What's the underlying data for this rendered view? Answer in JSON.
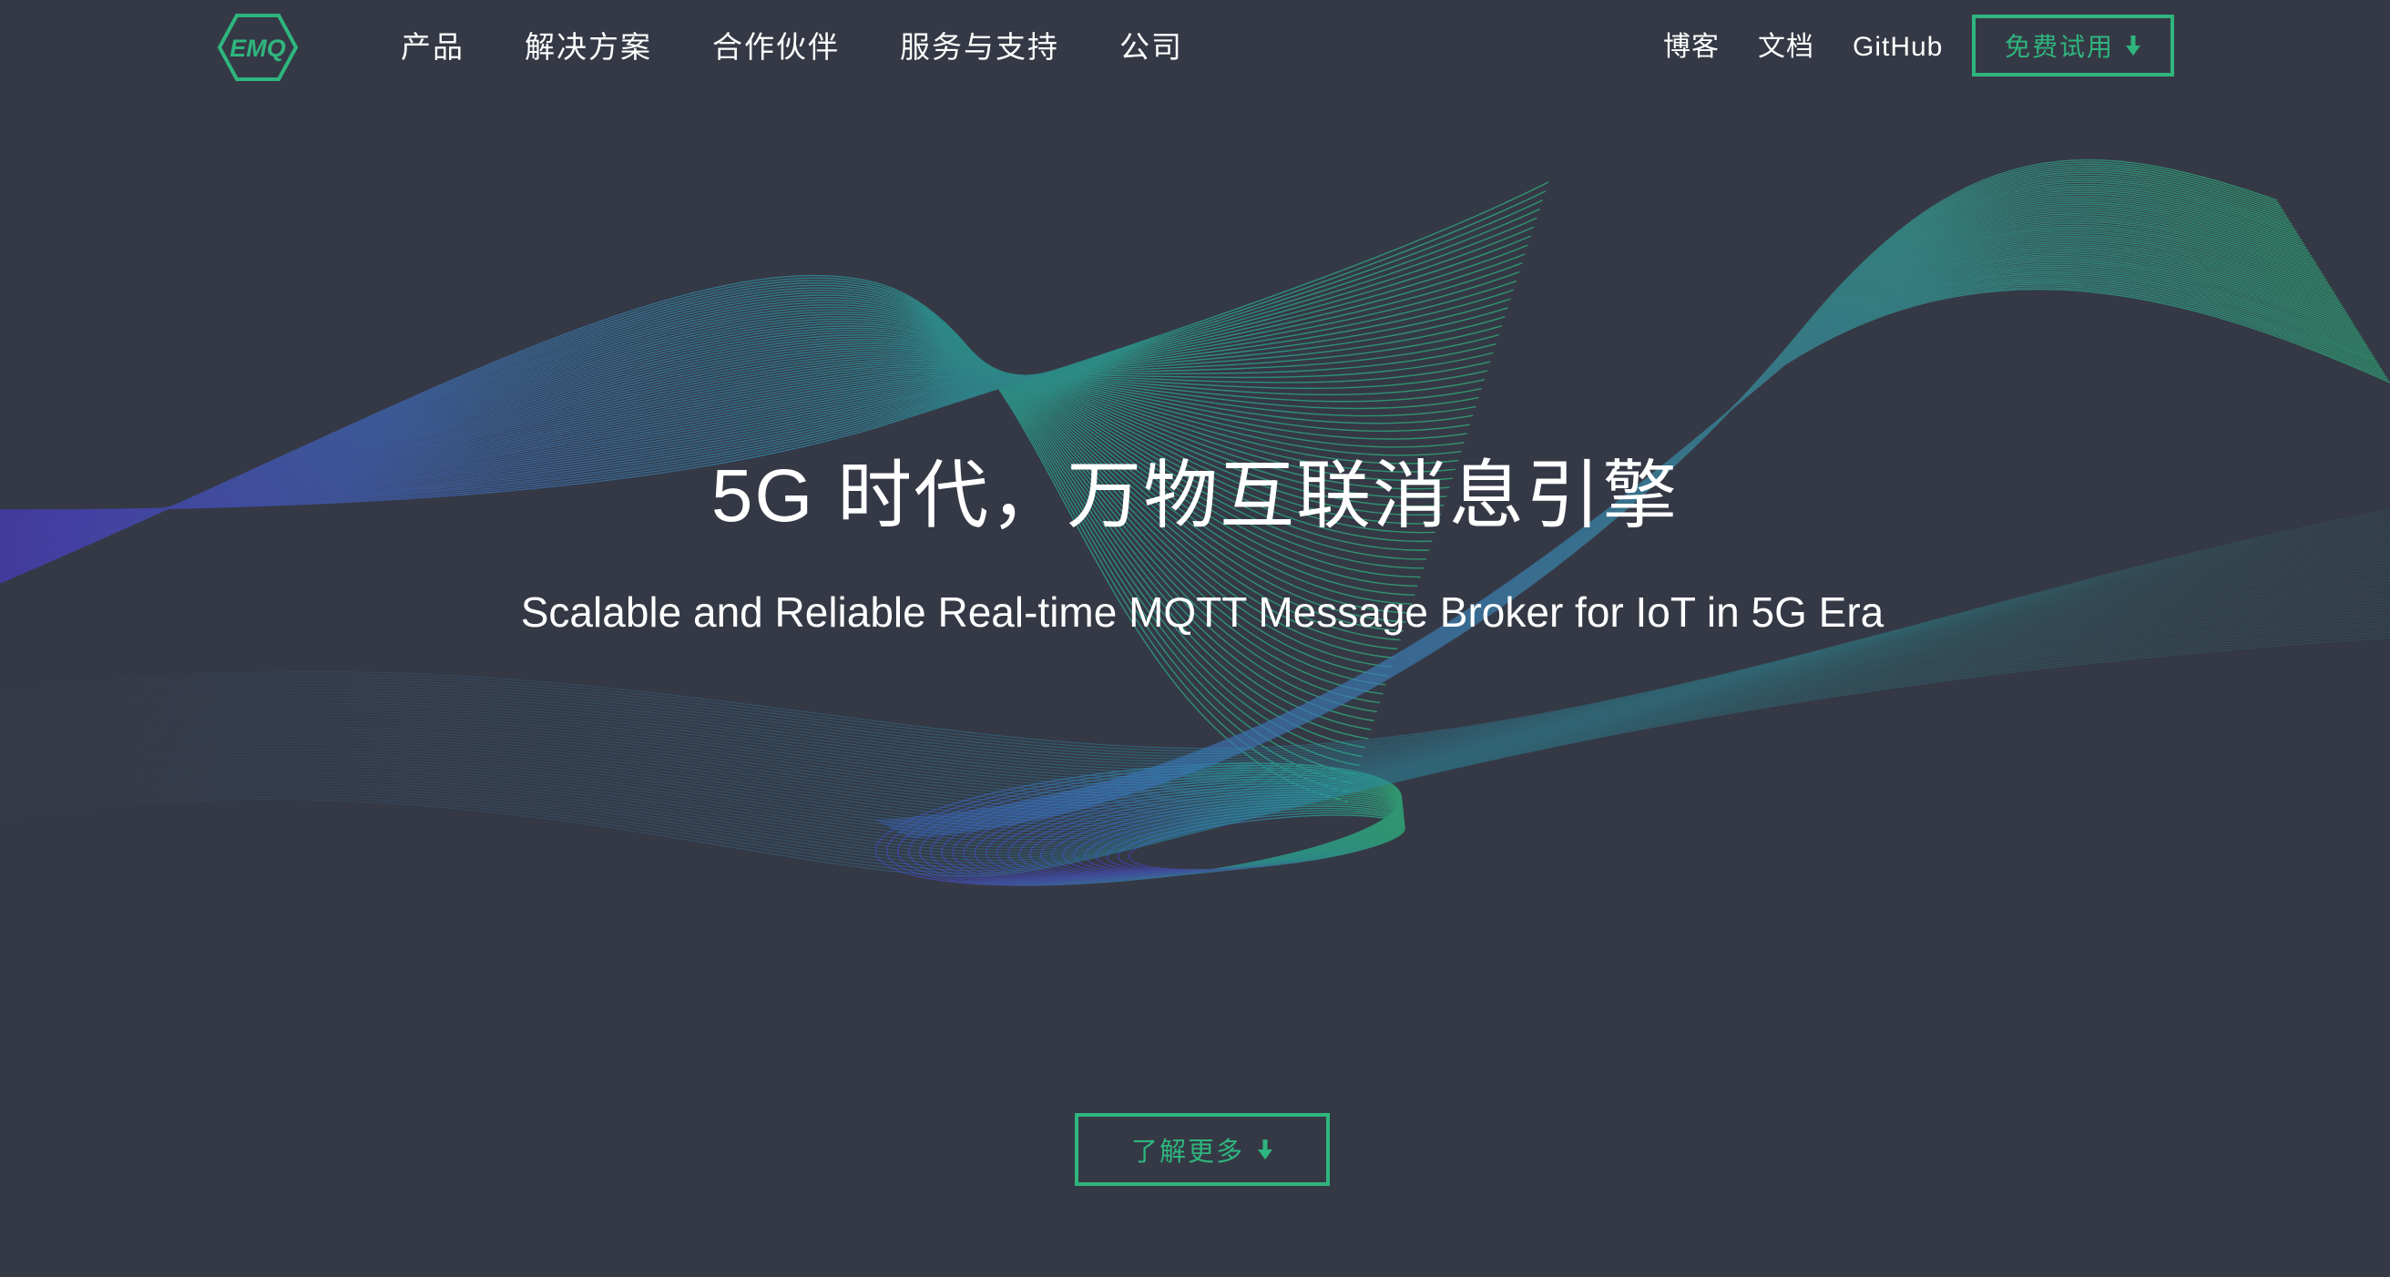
{
  "brand": {
    "logo_text": "EMQ",
    "logo_color": "#2fb57e"
  },
  "nav": {
    "left_items": [
      {
        "label": "产品"
      },
      {
        "label": "解决方案"
      },
      {
        "label": "合作伙伴"
      },
      {
        "label": "服务与支持"
      },
      {
        "label": "公司"
      }
    ],
    "right_items": [
      {
        "label": "博客"
      },
      {
        "label": "文档"
      },
      {
        "label": "GitHub"
      }
    ],
    "trial_button": {
      "label": "免费试用",
      "icon": "arrow-down-icon"
    }
  },
  "hero": {
    "title": "5G 时代，万物互联消息引擎",
    "subtitle": "Scalable and Reliable Real-time MQTT Message Broker for IoT in 5G Era",
    "more_button": {
      "label": "了解更多",
      "icon": "arrow-down-icon"
    }
  },
  "colors": {
    "background": "#353945",
    "accent": "#2fb57e",
    "wave_teal": "#2aa39a",
    "wave_blue": "#3d6fb0",
    "wave_purple": "#5b3fc0"
  }
}
